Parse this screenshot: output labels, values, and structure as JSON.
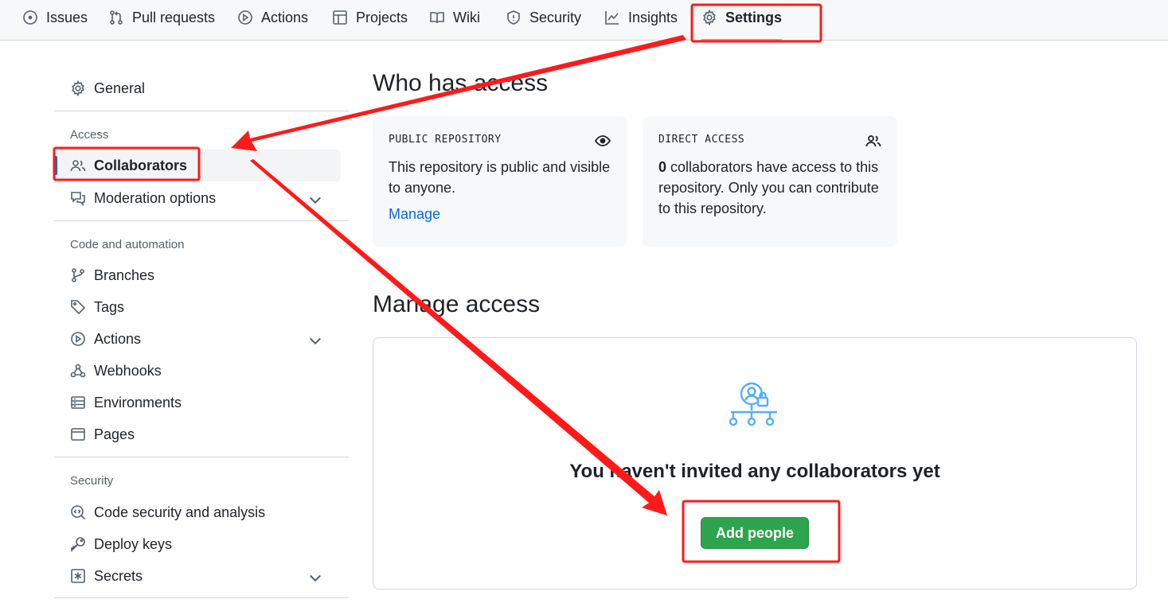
{
  "topnav": {
    "tabs": [
      {
        "label": "Issues",
        "icon": "issue-opened-icon"
      },
      {
        "label": "Pull requests",
        "icon": "git-pull-request-icon"
      },
      {
        "label": "Actions",
        "icon": "play-icon"
      },
      {
        "label": "Projects",
        "icon": "table-icon"
      },
      {
        "label": "Wiki",
        "icon": "book-icon"
      },
      {
        "label": "Security",
        "icon": "shield-icon"
      },
      {
        "label": "Insights",
        "icon": "graph-icon"
      },
      {
        "label": "Settings",
        "icon": "gear-icon",
        "active": true
      }
    ]
  },
  "sidebar": {
    "general": "General",
    "access_heading": "Access",
    "collaborators": "Collaborators",
    "moderation": "Moderation options",
    "code_heading": "Code and automation",
    "branches": "Branches",
    "tags": "Tags",
    "actions": "Actions",
    "webhooks": "Webhooks",
    "environments": "Environments",
    "pages": "Pages",
    "security_heading": "Security",
    "code_security": "Code security and analysis",
    "deploy_keys": "Deploy keys",
    "secrets": "Secrets"
  },
  "main": {
    "who_title": "Who has access",
    "public_card": {
      "label": "PUBLIC REPOSITORY",
      "text": "This repository is public and visible to anyone.",
      "link": "Manage"
    },
    "direct_card": {
      "label": "DIRECT ACCESS",
      "count": "0",
      "text": " collaborators have access to this repository. Only you can contribute to this repository."
    },
    "manage_title": "Manage access",
    "empty_title": "You haven't invited any collaborators yet",
    "add_button": "Add people"
  },
  "colors": {
    "accent": "#0969da",
    "primary_button": "#2da44e",
    "annotation": "#ff0000",
    "tab_underline": "#fd8c73"
  }
}
